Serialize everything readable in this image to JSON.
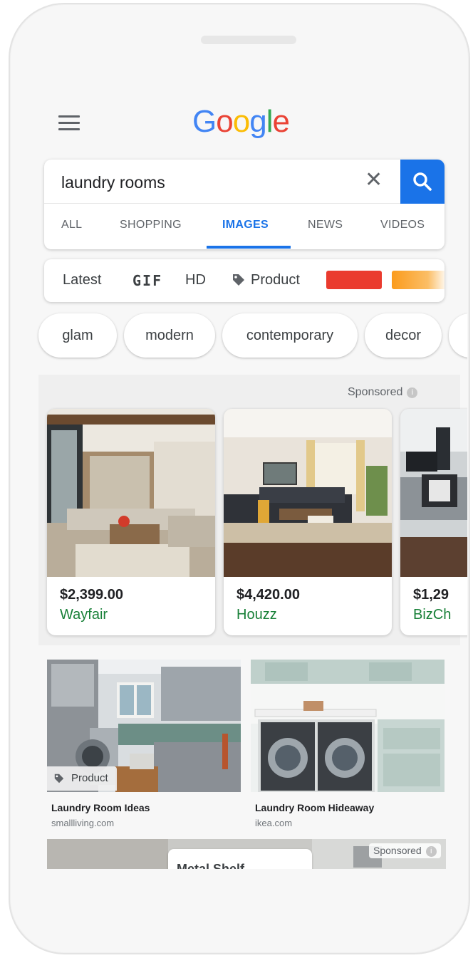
{
  "header": {
    "logo_text": "Google"
  },
  "search": {
    "query": "laundry rooms",
    "clear_symbol": "✕"
  },
  "tabs": [
    {
      "label": "ALL",
      "active": false
    },
    {
      "label": "SHOPPING",
      "active": false
    },
    {
      "label": "IMAGES",
      "active": true
    },
    {
      "label": "NEWS",
      "active": false
    },
    {
      "label": "VIDEOS",
      "active": false
    }
  ],
  "filters": {
    "latest": "Latest",
    "gif": "GIF",
    "hd": "HD",
    "product": "Product",
    "color_swatches": [
      "#ea3b2e",
      "#fb9b1c"
    ]
  },
  "suggestions": [
    "glam",
    "modern",
    "contemporary",
    "decor"
  ],
  "sponsored": {
    "label": "Sponsored",
    "info_symbol": "i",
    "products": [
      {
        "price": "$2,399.00",
        "seller": "Wayfair"
      },
      {
        "price": "$4,420.00",
        "seller": "Houzz"
      },
      {
        "price": "$1,29",
        "seller": "BizCh"
      }
    ]
  },
  "results": [
    {
      "title": "Laundry Room Ideas",
      "domain": "smallliving.com",
      "badge": "Product"
    },
    {
      "title": "Laundry Room Hideaway",
      "domain": "ikea.com"
    }
  ],
  "bottom": {
    "card_text": "Metal Shelf",
    "sponsored": "Sponsored"
  },
  "icons": [
    "menu-icon",
    "clear-icon",
    "search-icon",
    "tag-icon",
    "info-icon"
  ],
  "colors": {
    "accent": "#1a73e8",
    "seller_green": "#188038"
  }
}
